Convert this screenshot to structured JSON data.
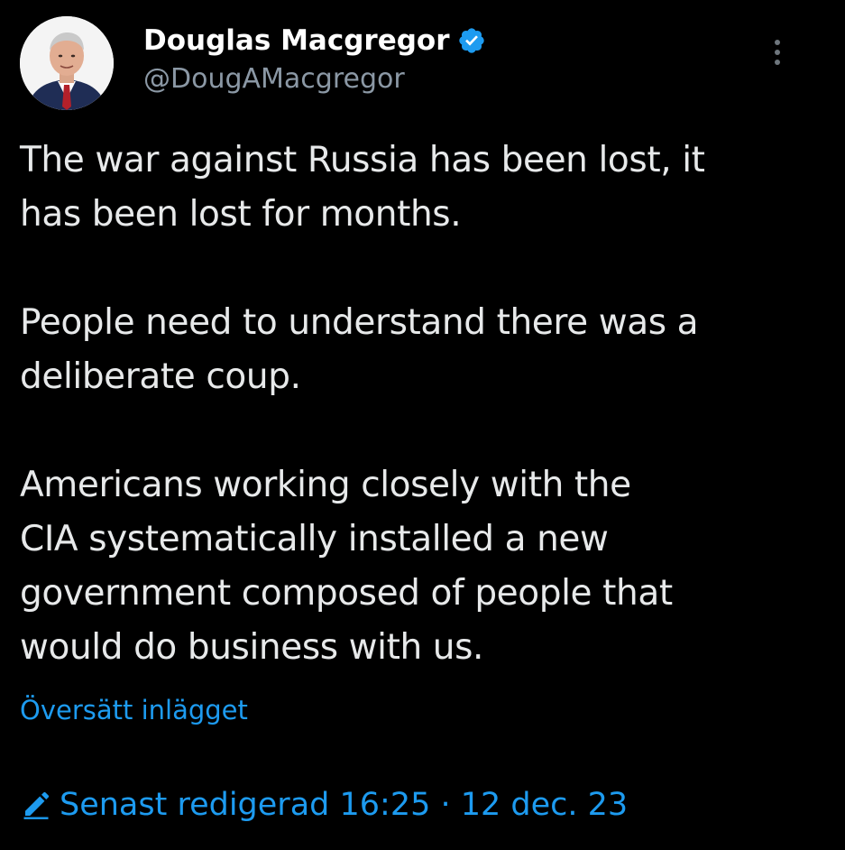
{
  "author": {
    "display_name": "Douglas Macgregor",
    "handle": "@DougAMacgregor",
    "verified_icon": "verified-badge-icon",
    "avatar_icon": "profile-avatar"
  },
  "menu": {
    "icon": "more-options-icon"
  },
  "post": {
    "paragraphs": [
      "The war against Russia has been lost, it\nhas been lost for months.",
      "People need to understand there was a\ndeliberate coup.",
      "Americans working closely with the\nCIA systematically installed a new\ngovernment composed of people that\nwould do business with us."
    ]
  },
  "translate_link": "Översätt inlägget",
  "edit_info": {
    "icon": "pencil-icon",
    "text": "Senast redigerad 16:25 · 12 dec. 23"
  },
  "colors": {
    "background": "#000000",
    "text": "#e7e9ea",
    "secondary_text": "#8b98a5",
    "accent": "#1d9bf0"
  }
}
